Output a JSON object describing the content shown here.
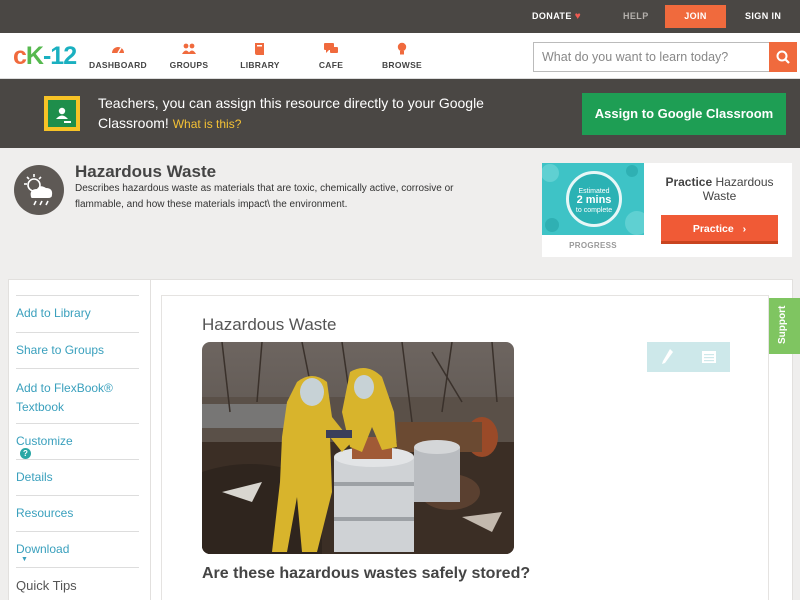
{
  "topbar": {
    "donate": "DONATE",
    "help": "HELP",
    "join": "JOIN",
    "sign_in": "SIGN IN"
  },
  "nav": {
    "logo": {
      "c": "c",
      "k": "K",
      "dash": "-",
      "num": "12"
    },
    "items": [
      {
        "label": "DASHBOARD",
        "icon": "gauge-icon"
      },
      {
        "label": "GROUPS",
        "icon": "people-icon"
      },
      {
        "label": "LIBRARY",
        "icon": "book-icon"
      },
      {
        "label": "CAFE",
        "icon": "chat-icon"
      },
      {
        "label": "BROWSE",
        "icon": "bulb-icon"
      }
    ],
    "search_placeholder": "What do you want to learn today?"
  },
  "banner": {
    "text": "Teachers, you can assign this resource directly to your Google Classroom!",
    "what_link": "What is this?",
    "assign_button": "Assign to Google Classroom"
  },
  "concept": {
    "title": "Hazardous Waste",
    "description": "Describes hazardous waste as materials that are toxic, chemically active, corrosive or flammable, and how these materials impact\\ the environment."
  },
  "practice": {
    "ring_top": "Estimated",
    "ring_mid": "2 mins",
    "ring_bottom": "to complete",
    "progress_label": "PROGRESS",
    "title_bold": "Practice",
    "title_rest": "Hazardous Waste",
    "button": "Practice"
  },
  "sidebar": {
    "items": [
      {
        "label": "Add to Library"
      },
      {
        "label": "Share to Groups"
      },
      {
        "label": "Add to FlexBook® Textbook"
      },
      {
        "label": "Customize",
        "help": "?"
      },
      {
        "label": "Details"
      },
      {
        "label": "Resources"
      },
      {
        "label": "Download",
        "caret": "▼"
      },
      {
        "label": "Quick Tips"
      }
    ]
  },
  "article": {
    "title": "Hazardous Waste",
    "caption": "Are these hazardous wastes safely stored?"
  },
  "support": "Support",
  "colors": {
    "accent_orange": "#f06a3d",
    "dark_bar": "#4a4744",
    "green": "#1e9e54",
    "link": "#3aa0bd"
  }
}
